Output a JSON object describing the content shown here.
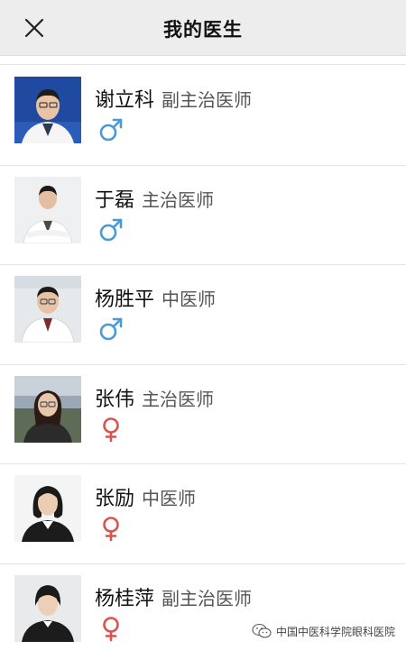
{
  "header": {
    "title": "我的医生",
    "close_icon": "close-icon"
  },
  "doctors": [
    {
      "name": "谢立科",
      "title": "副主治医师",
      "gender": "male",
      "gender_icon": "male-icon",
      "avatar_bg": "#1f4aa0"
    },
    {
      "name": "于磊",
      "title": "主治医师",
      "gender": "male",
      "gender_icon": "male-icon",
      "avatar_bg": "#eef0f2"
    },
    {
      "name": "杨胜平",
      "title": "中医师",
      "gender": "male",
      "gender_icon": "male-icon",
      "avatar_bg": "#e6e9ec"
    },
    {
      "name": "张伟",
      "title": "主治医师",
      "gender": "female",
      "gender_icon": "female-icon",
      "avatar_bg": "#8a97a6"
    },
    {
      "name": "张励",
      "title": "中医师",
      "gender": "female",
      "gender_icon": "female-icon",
      "avatar_bg": "#f4f4f4"
    },
    {
      "name": "杨桂萍",
      "title": "副主治医师",
      "gender": "female",
      "gender_icon": "female-icon",
      "avatar_bg": "#e9eaec"
    }
  ],
  "watermark": {
    "text": "中国中医科学院眼科医院",
    "icon": "wechat-icon"
  },
  "colors": {
    "male": "#4a9ad6",
    "female": "#d9534f",
    "nav_bg": "#ededed"
  }
}
